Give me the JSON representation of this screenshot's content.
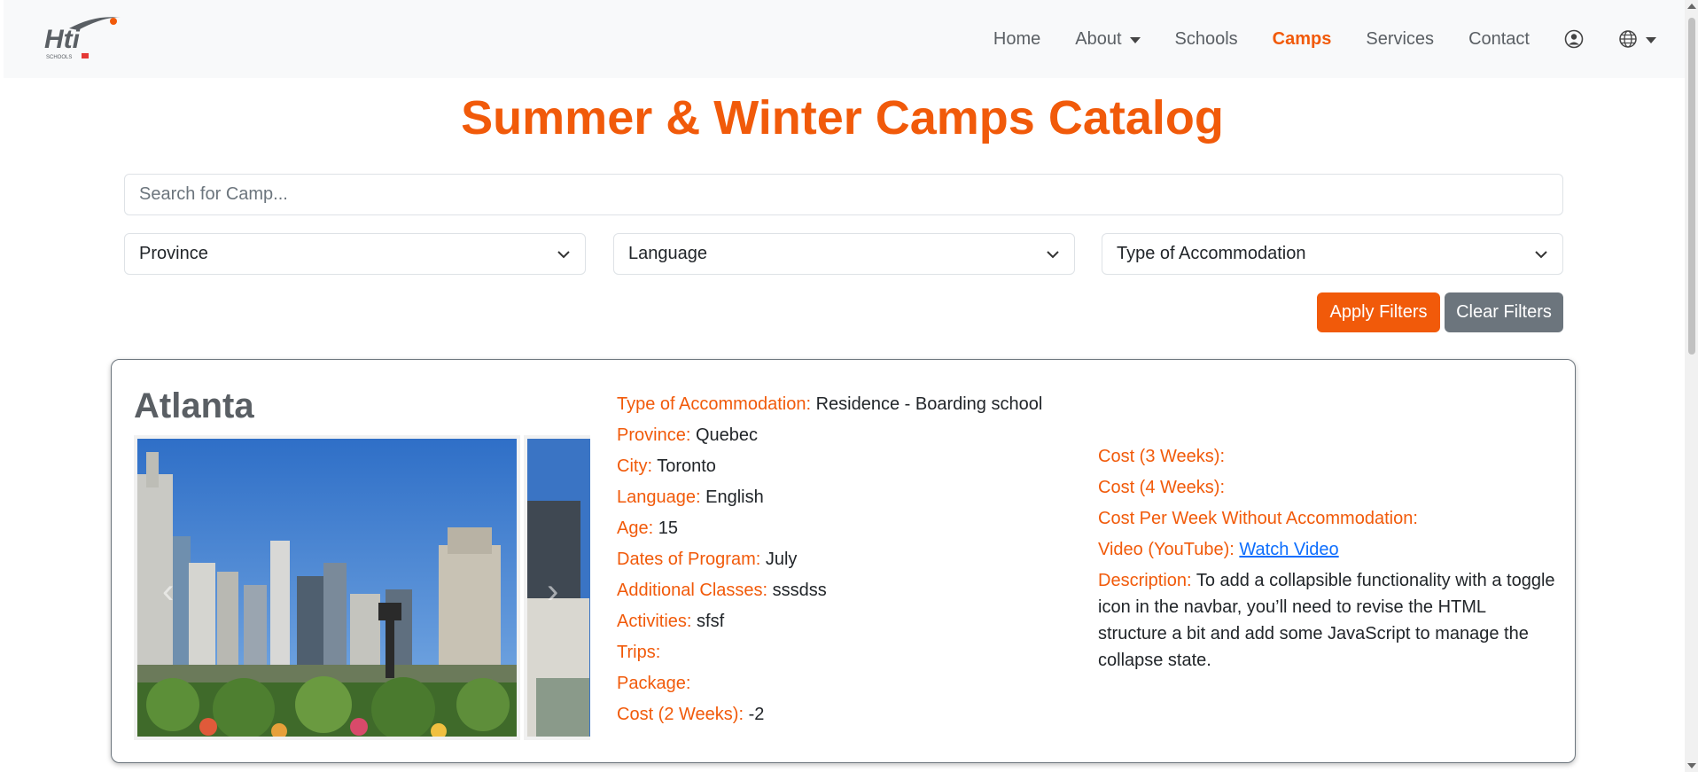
{
  "brand": {
    "logo_text": "Hti",
    "logo_subtext": "SCHOOLS"
  },
  "nav": {
    "home": "Home",
    "about": "About",
    "schools": "Schools",
    "camps": "Camps",
    "services": "Services",
    "contact": "Contact"
  },
  "page": {
    "title": "Summer & Winter Camps Catalog"
  },
  "search": {
    "placeholder": "Search for Camp..."
  },
  "filters": {
    "province": "Province",
    "language": "Language",
    "accommodation": "Type of Accommodation"
  },
  "buttons": {
    "apply": "Apply Filters",
    "clear": "Clear Filters"
  },
  "camp": {
    "name": "Atlanta",
    "details_left": [
      {
        "label": "Type of Accommodation:",
        "value": "Residence - Boarding school"
      },
      {
        "label": "Province:",
        "value": "Quebec"
      },
      {
        "label": "City:",
        "value": "Toronto"
      },
      {
        "label": "Language:",
        "value": "English"
      },
      {
        "label": "Age:",
        "value": "15"
      },
      {
        "label": "Dates of Program:",
        "value": "July"
      },
      {
        "label": "Additional Classes:",
        "value": "sssdss"
      },
      {
        "label": "Activities:",
        "value": "sfsf"
      },
      {
        "label": "Trips:",
        "value": ""
      },
      {
        "label": "Package:",
        "value": ""
      },
      {
        "label": "Cost (2 Weeks):",
        "value": "-2"
      }
    ],
    "details_right": [
      {
        "label": "Cost (3 Weeks):",
        "value": ""
      },
      {
        "label": "Cost (4 Weeks):",
        "value": ""
      },
      {
        "label": "Cost Per Week Without Accommodation:",
        "value": ""
      }
    ],
    "video_label": "Video (YouTube):",
    "video_link": "Watch Video",
    "description_label": "Description:",
    "description": "To add a collapsible functionality with a toggle icon in the navbar, you’ll need to revise the HTML structure a bit and add some JavaScript to manage the collapse state."
  },
  "colors": {
    "accent": "#f15a0a",
    "secondary": "#6c757d",
    "link": "#0d6efd"
  },
  "icons": [
    "user-circle-icon",
    "globe-icon",
    "chevron-down-icon",
    "chevron-left-icon",
    "chevron-right-icon"
  ]
}
